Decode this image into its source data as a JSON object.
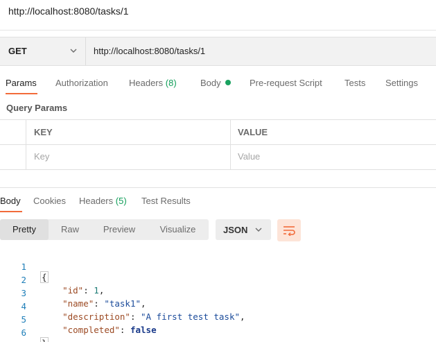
{
  "address": "http://localhost:8080/tasks/1",
  "request": {
    "method": "GET",
    "url": "http://localhost:8080/tasks/1"
  },
  "request_tabs": {
    "params": "Params",
    "authorization": "Authorization",
    "headers": "Headers",
    "headers_count": "(8)",
    "body": "Body",
    "pre_request": "Pre-request Script",
    "tests": "Tests",
    "settings": "Settings"
  },
  "query_params": {
    "title": "Query Params",
    "key_header": "KEY",
    "value_header": "VALUE",
    "key_placeholder": "Key",
    "value_placeholder": "Value"
  },
  "response_tabs": {
    "body": "Body",
    "cookies": "Cookies",
    "headers": "Headers",
    "headers_count": "(5)",
    "test_results": "Test Results"
  },
  "response_view": {
    "pretty": "Pretty",
    "raw": "Raw",
    "preview": "Preview",
    "visualize": "Visualize",
    "language": "JSON"
  },
  "code_lines": [
    {
      "n": "1",
      "key": "",
      "value": "",
      "open": "{"
    },
    {
      "n": "2",
      "key": "\"id\"",
      "value": "1",
      "kind": "num"
    },
    {
      "n": "3",
      "key": "\"name\"",
      "value": "\"task1\"",
      "kind": "str"
    },
    {
      "n": "4",
      "key": "\"description\"",
      "value": "\"A first test task\"",
      "kind": "str"
    },
    {
      "n": "5",
      "key": "\"completed\"",
      "value": "false",
      "kind": "bool"
    },
    {
      "n": "6",
      "key": "",
      "value": "",
      "close": "}"
    }
  ],
  "colors": {
    "accent": "#f26b3a",
    "count_green": "#0f9d58",
    "line_number": "#1e7eb8"
  },
  "icons": {
    "method_dropdown": "chevron-down-icon",
    "language_dropdown": "chevron-down-icon",
    "wrap": "wrap-lines-icon",
    "body_indicator": "status-dot-icon"
  }
}
